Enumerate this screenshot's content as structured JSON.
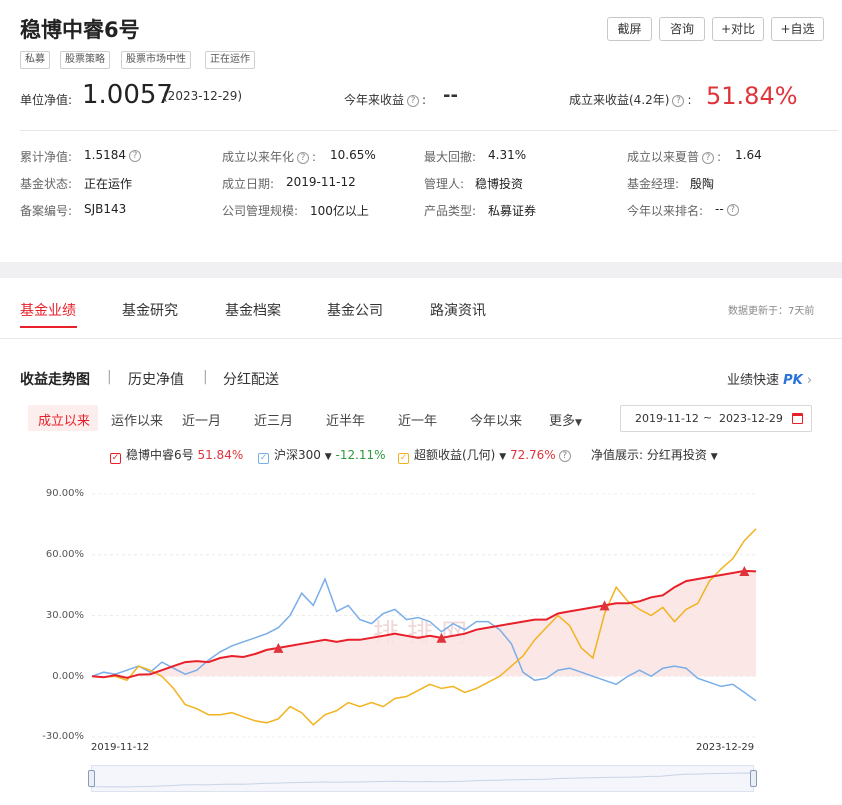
{
  "fund": {
    "name": "稳博中睿6号",
    "tags": [
      "私募",
      "股票策略",
      "股票市场中性",
      "正在运作"
    ],
    "actions": [
      "截屏",
      "咨询",
      "+对比",
      "+自选"
    ],
    "nav_label": "单位净值:",
    "nav_value": "1.0057",
    "nav_date": "(2023-12-29)",
    "ytd_label": "今年来收益",
    "ytd_value": "--",
    "since_label": "成立来收益(4.2年)",
    "since_value": "51.84%",
    "stats": [
      {
        "label": "累计净值:",
        "value": "1.5184"
      },
      {
        "label": "成立以来年化",
        "value": "10.65%"
      },
      {
        "label": "最大回撤:",
        "value": "4.31%"
      },
      {
        "label": "成立以来夏普",
        "value": "1.64"
      },
      {
        "label": "基金状态:",
        "value": "正在运作"
      },
      {
        "label": "成立日期:",
        "value": "2019-11-12"
      },
      {
        "label": "管理人:",
        "value": "稳博投资"
      },
      {
        "label": "基金经理:",
        "value": "殷陶"
      },
      {
        "label": "备案编号:",
        "value": "SJB143"
      },
      {
        "label": "公司管理规模:",
        "value": "100亿以上"
      },
      {
        "label": "产品类型:",
        "value": "私募证券"
      },
      {
        "label": "今年以来排名:",
        "value": "--"
      }
    ]
  },
  "tabs": [
    "基金业绩",
    "基金研究",
    "基金档案",
    "基金公司",
    "路演资讯"
  ],
  "update_note": "数据更新于：7天前",
  "subtabs": [
    "收益走势图",
    "历史净值",
    "分红配送"
  ],
  "subtab_sep": "|",
  "pk_label": "业绩快速",
  "pk_badge": "PK",
  "ranges": [
    "成立以来",
    "运作以来",
    "近一月",
    "近三月",
    "近半年",
    "近一年",
    "今年以来",
    "更多"
  ],
  "date_start": "2019-11-12",
  "date_sep": "~",
  "date_end": "2023-12-29",
  "legend": {
    "fund_name": "稳博中睿6号",
    "fund_value": "51.84%",
    "idx_name": "沪深300",
    "idx_value": "-12.11%",
    "excess_name": "超额收益(几何)",
    "excess_value": "72.76%",
    "display_label": "净值展示:",
    "display_value": "分红再投资"
  },
  "colors": {
    "fund": "#e8202a",
    "index": "#7aaee8",
    "excess": "#f2b320",
    "up": "#e0343c",
    "down": "#2f9a3a",
    "accent": "#e8202a"
  },
  "chart_data": {
    "type": "line",
    "x_start": "2019-11-12",
    "x_end": "2023-12-29",
    "yticks": [
      "90.00%",
      "60.00%",
      "30.00%",
      "0.00%",
      "-30.00%"
    ],
    "ylim": [
      -30,
      90
    ],
    "series": [
      {
        "name": "稳博中睿6号",
        "values": [
          0,
          -0.5,
          0.5,
          -0.8,
          0.8,
          1,
          3,
          5,
          7,
          7.5,
          7,
          9,
          10,
          9.5,
          11,
          13,
          14,
          15,
          16,
          17,
          18,
          17,
          18,
          18,
          19,
          20,
          21,
          20,
          19,
          20,
          19,
          20,
          21,
          23,
          24,
          25,
          26,
          27,
          28,
          28,
          31,
          32,
          33,
          34,
          35,
          36,
          36,
          37,
          39,
          40,
          44,
          47,
          48,
          49,
          50,
          51,
          52,
          51.8
        ]
      },
      {
        "name": "沪深300",
        "values": [
          0,
          2,
          1,
          3,
          5,
          2,
          7,
          4,
          1,
          3,
          8,
          12,
          15,
          17,
          19,
          21,
          24,
          30,
          41,
          35,
          48,
          32,
          35,
          28,
          26,
          31,
          33,
          28,
          29,
          27,
          22,
          26,
          23,
          27,
          27,
          23,
          16,
          2,
          -2,
          -1,
          3,
          4,
          2,
          0,
          -2,
          -4,
          0,
          3,
          0,
          4,
          5,
          4,
          -1,
          -3,
          -5,
          -4,
          -8,
          -12.1
        ]
      },
      {
        "name": "超额收益(几何)",
        "values": [
          0,
          -0.5,
          0,
          -2,
          5,
          3,
          0,
          -6,
          -14,
          -16,
          -19,
          -19,
          -18,
          -20,
          -22,
          -23,
          -21,
          -15,
          -18,
          -24,
          -19,
          -17,
          -13,
          -15,
          -13,
          -15,
          -11,
          -10,
          -7,
          -4,
          -6,
          -5,
          -8,
          -6,
          -3,
          0,
          5,
          10,
          18,
          24,
          30,
          25,
          14,
          9,
          31,
          44,
          37,
          33,
          30,
          34,
          27,
          33,
          36,
          47,
          53,
          58,
          67,
          72.8
        ]
      }
    ]
  }
}
